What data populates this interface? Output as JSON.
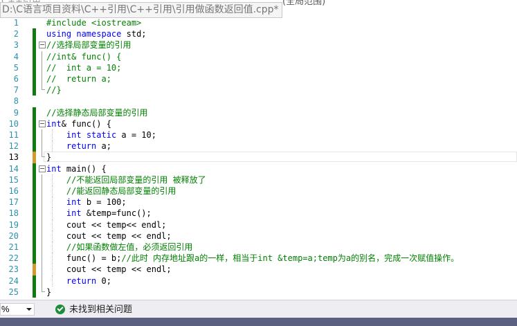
{
  "window": {
    "tooltip_path": "D:\\C语言项目资料\\C++引用\\C++引用\\引用做函数返回值.cpp*",
    "ghost_left": "C++引用",
    "ghost_right": "(全局范围)"
  },
  "editor": {
    "lines": [
      {
        "n": "1",
        "html": "<span class=\"cm\">#include &lt;iostream&gt;</span>"
      },
      {
        "n": "2",
        "html": "<span class=\"kw\">using</span> <span class=\"kw\">namespace</span> std;"
      },
      {
        "n": "3",
        "html": "<span class=\"cm\">//选择局部变量的引用</span>"
      },
      {
        "n": "4",
        "html": "<span class=\"cm\">//int&amp; func() {</span>"
      },
      {
        "n": "5",
        "html": "<span class=\"cm\">//  int a = 10;</span>"
      },
      {
        "n": "6",
        "html": "<span class=\"cm\">//  return a;</span>"
      },
      {
        "n": "7",
        "html": "<span class=\"cm\">//}</span>"
      },
      {
        "n": "8",
        "html": ""
      },
      {
        "n": "9",
        "html": "<span class=\"cm\">//选择静态局部变量的引用</span>"
      },
      {
        "n": "10",
        "html": "<span class=\"kw\">int</span>&amp; func() {"
      },
      {
        "n": "11",
        "html": "    <span class=\"kw\">int</span> <span class=\"kw\">static</span> a = 10;"
      },
      {
        "n": "12",
        "html": "    <span class=\"kw\">return</span> a;"
      },
      {
        "n": "13",
        "html": "}"
      },
      {
        "n": "14",
        "html": "<span class=\"kw\">int</span> main() {"
      },
      {
        "n": "15",
        "html": "    <span class=\"cm\">//不能返回局部变量的引用 被释放了</span>"
      },
      {
        "n": "16",
        "html": "    <span class=\"cm\">//能返回静态局部变量的引用</span>"
      },
      {
        "n": "17",
        "html": "    <span class=\"kw\">int</span> b = 100;"
      },
      {
        "n": "18",
        "html": "    <span class=\"kw\">int</span> &amp;temp=func();"
      },
      {
        "n": "19",
        "html": "    cout &lt;&lt; temp&lt;&lt; endl;"
      },
      {
        "n": "20",
        "html": "    cout &lt;&lt; temp &lt;&lt; endl;"
      },
      {
        "n": "21",
        "html": "    <span class=\"cm\">//如果函数做左值，必须返回引用</span>"
      },
      {
        "n": "22",
        "html": "    func() = b;<span class=\"cm\">//此时 内存地址跟a的一样，相当于int &amp;temp=a;temp为a的别名，完成一次赋值操作。</span>"
      },
      {
        "n": "23",
        "html": "    cout &lt;&lt; temp &lt;&lt; endl;"
      },
      {
        "n": "24",
        "html": "    <span class=\"kw\">return</span> 0;"
      },
      {
        "n": "25",
        "html": "}"
      }
    ]
  },
  "status": {
    "zoom": "%",
    "issues": "未找到相关问题"
  }
}
